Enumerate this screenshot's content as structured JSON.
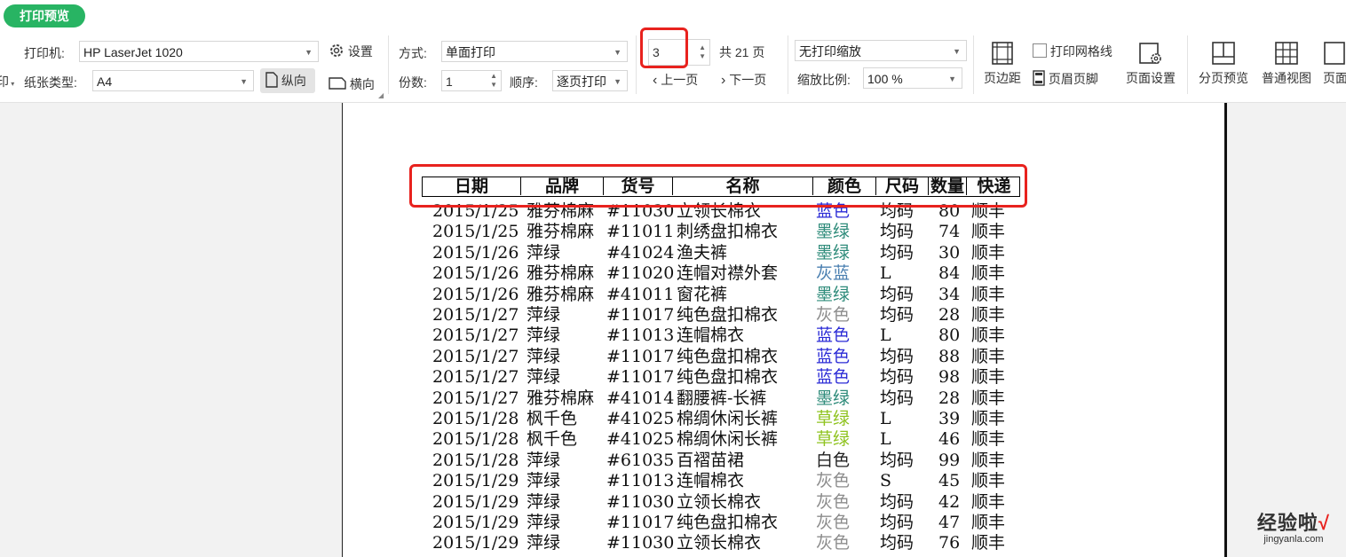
{
  "tab": {
    "label": "打印预览"
  },
  "toolbar": {
    "left_edge_label": "印",
    "printer_label": "打印机:",
    "printer_value": "HP LaserJet 1020",
    "settings_label": "设置",
    "paper_type_label": "纸张类型:",
    "paper_type_value": "A4",
    "portrait_label": "纵向",
    "landscape_label": "横向",
    "mode_label": "方式:",
    "mode_value": "单面打印",
    "copies_label": "份数:",
    "copies_value": "1",
    "order_label": "顺序:",
    "order_value": "逐页打印",
    "page_input": "3",
    "total_pages": "共 21 页",
    "prev_page": "上一页",
    "next_page": "下一页",
    "scale_mode_value": "无打印缩放",
    "scale_ratio_label": "缩放比例:",
    "scale_ratio_value": "100 %",
    "margins_label": "页边距",
    "gridlines_label": "打印网格线",
    "header_footer_label": "页眉页脚",
    "page_setup_label": "页面设置",
    "page_break_preview_label": "分页预览",
    "normal_view_label": "普通视图",
    "page_view_label": "页面"
  },
  "table": {
    "headers": [
      "日期",
      "品牌",
      "货号",
      "名称",
      "颜色",
      "尺码",
      "数量",
      "快递"
    ],
    "rows": [
      [
        "2015/1/25",
        "雅芬棉麻",
        "#11030",
        "立领长棉衣",
        "蓝色",
        "均码",
        "80",
        "顺丰"
      ],
      [
        "2015/1/25",
        "雅芬棉麻",
        "#11011",
        "刺绣盘扣棉衣",
        "墨绿",
        "均码",
        "74",
        "顺丰"
      ],
      [
        "2015/1/26",
        "萍绿",
        "#41024",
        "渔夫裤",
        "墨绿",
        "均码",
        "30",
        "顺丰"
      ],
      [
        "2015/1/26",
        "雅芬棉麻",
        "#11020",
        "连帽对襟外套",
        "灰蓝",
        "L",
        "84",
        "顺丰"
      ],
      [
        "2015/1/26",
        "雅芬棉麻",
        "#41011",
        "窗花裤",
        "墨绿",
        "均码",
        "34",
        "顺丰"
      ],
      [
        "2015/1/27",
        "萍绿",
        "#11017",
        "纯色盘扣棉衣",
        "灰色",
        "均码",
        "28",
        "顺丰"
      ],
      [
        "2015/1/27",
        "萍绿",
        "#11013",
        "连帽棉衣",
        "蓝色",
        "L",
        "80",
        "顺丰"
      ],
      [
        "2015/1/27",
        "萍绿",
        "#11017",
        "纯色盘扣棉衣",
        "蓝色",
        "均码",
        "88",
        "顺丰"
      ],
      [
        "2015/1/27",
        "萍绿",
        "#11017",
        "纯色盘扣棉衣",
        "蓝色",
        "均码",
        "98",
        "顺丰"
      ],
      [
        "2015/1/27",
        "雅芬棉麻",
        "#41014",
        "翻腰裤-长裤",
        "墨绿",
        "均码",
        "28",
        "顺丰"
      ],
      [
        "2015/1/28",
        "枫千色",
        "#41025",
        "棉绸休闲长裤",
        "草绿",
        "L",
        "39",
        "顺丰"
      ],
      [
        "2015/1/28",
        "枫千色",
        "#41025",
        "棉绸休闲长裤",
        "草绿",
        "L",
        "46",
        "顺丰"
      ],
      [
        "2015/1/28",
        "萍绿",
        "#61035",
        "百褶苗裙",
        "白色",
        "均码",
        "99",
        "顺丰"
      ],
      [
        "2015/1/29",
        "萍绿",
        "#11013",
        "连帽棉衣",
        "灰色",
        "S",
        "45",
        "顺丰"
      ],
      [
        "2015/1/29",
        "萍绿",
        "#11030",
        "立领长棉衣",
        "灰色",
        "均码",
        "42",
        "顺丰"
      ],
      [
        "2015/1/29",
        "萍绿",
        "#11017",
        "纯色盘扣棉衣",
        "灰色",
        "均码",
        "47",
        "顺丰"
      ],
      [
        "2015/1/29",
        "萍绿",
        "#11030",
        "立领长棉衣",
        "灰色",
        "均码",
        "76",
        "顺丰"
      ]
    ],
    "color_map": {
      "蓝色": "#2b2bd6",
      "墨绿": "#2e8b7a",
      "灰蓝": "#4a7fb0",
      "灰色": "#8c8c8c",
      "草绿": "#8fc31f",
      "白色": "#222222"
    }
  },
  "colors": {
    "accent": "#28b463",
    "highlight": "#e8221e"
  },
  "watermark": {
    "text": "经验啦",
    "check": "√",
    "url": "jingyanla.com"
  }
}
